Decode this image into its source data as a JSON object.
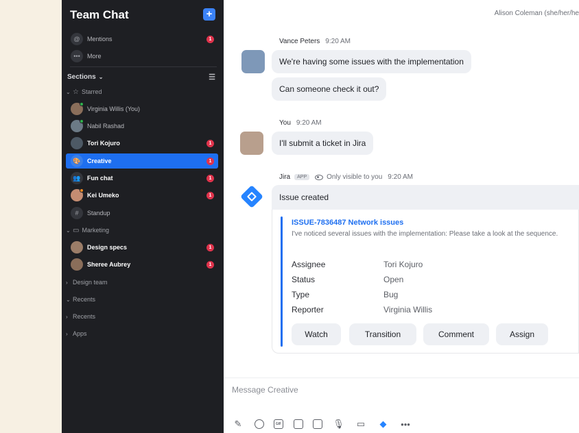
{
  "sidebar": {
    "title": "Team Chat",
    "compose_icon": "plus",
    "top_items": [
      {
        "label": "Mentions",
        "icon": "at-sign",
        "badge": "1"
      },
      {
        "label": "More",
        "icon": "ellipsis"
      }
    ],
    "sections_label": "Sections",
    "starred_label": "Starred",
    "starred_items": [
      {
        "label": "Virginia Willis (You)",
        "icon": "avatar",
        "status": "online"
      },
      {
        "label": "Nabil Rashad",
        "icon": "avatar",
        "status": "online"
      },
      {
        "label": "Tori Kojuro",
        "icon": "avatar",
        "badge": "1",
        "bold": true
      },
      {
        "label": "Creative",
        "icon": "palette",
        "badge": "1",
        "active": true
      },
      {
        "label": "Fun chat",
        "icon": "people",
        "badge": "1",
        "bold": true
      },
      {
        "label": "Kei Umeko",
        "icon": "avatar",
        "badge": "1",
        "bold": true,
        "status": "away"
      },
      {
        "label": "Standup",
        "icon": "hash"
      }
    ],
    "marketing_label": "Marketing",
    "marketing_items": [
      {
        "label": "Design specs",
        "icon": "avatar",
        "badge": "1",
        "bold": true
      },
      {
        "label": "Sheree Aubrey",
        "icon": "avatar",
        "badge": "1",
        "bold": true
      }
    ],
    "groups": [
      {
        "label": "Design team",
        "chevron": "right"
      },
      {
        "label": "Recents",
        "chevron": "down"
      },
      {
        "label": "Recents",
        "chevron": "right"
      },
      {
        "label": "Apps",
        "chevron": "right"
      }
    ]
  },
  "chat": {
    "header_user": "Alison Coleman (she/her/he",
    "messages": [
      {
        "sender": "Vance Peters",
        "time": "9:20 AM",
        "texts": [
          "We're having some issues with the implementation",
          "Can someone check it out?"
        ]
      },
      {
        "sender": "You",
        "time": "9:20 AM",
        "texts": [
          "I'll submit a ticket in Jira"
        ]
      }
    ],
    "jira": {
      "sender": "Jira",
      "app_tag": "APP",
      "visibility": "Only visible to you",
      "time": "9:20 AM",
      "title": "Issue created",
      "issue_link": "ISSUE-7836487 Network issues",
      "description": "I've noticed several issues with the implementation: Please take a look at the sequence.",
      "fields": [
        {
          "key": "Assignee",
          "value": "Tori Kojuro"
        },
        {
          "key": "Status",
          "value": "Open"
        },
        {
          "key": "Type",
          "value": "Bug"
        },
        {
          "key": "Reporter",
          "value": "Virginia Willis"
        }
      ],
      "actions": [
        "Watch",
        "Transition",
        "Comment",
        "Assign"
      ]
    },
    "composer_placeholder": "Message Creative",
    "toolbar_icons": [
      "pen",
      "emoji",
      "gif",
      "file",
      "screenshot",
      "microphone",
      "video",
      "jira",
      "more"
    ]
  },
  "colors": {
    "accent": "#1e6ff0",
    "badge": "#e0334c",
    "sidebar_bg": "#1e1f23",
    "jira_blue": "#2684ff"
  }
}
